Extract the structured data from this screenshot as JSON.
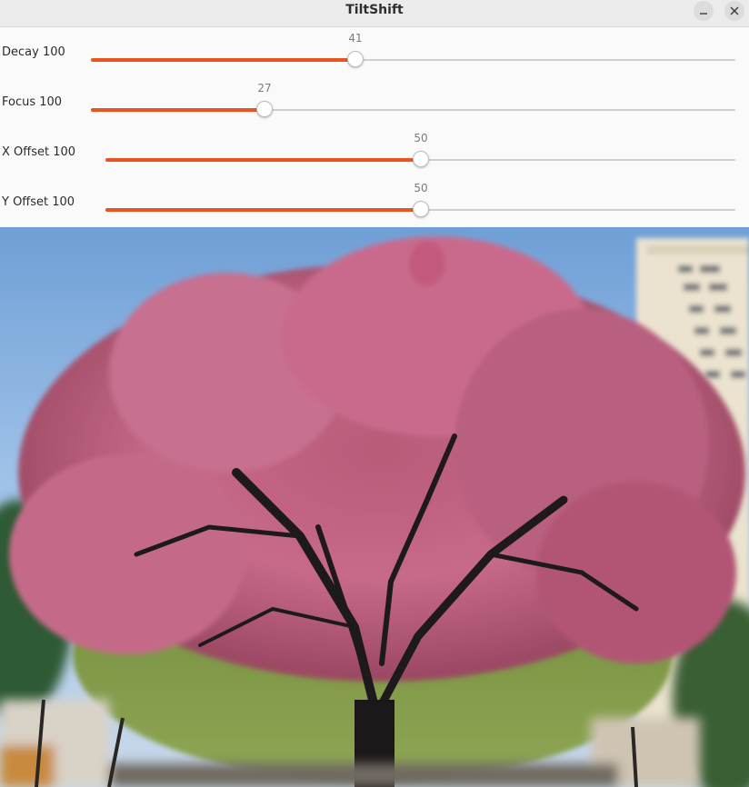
{
  "window": {
    "title": "TiltShift",
    "minimize_icon": "minimize-icon",
    "close_icon": "close-icon"
  },
  "sliders": [
    {
      "label": "Decay 100",
      "value": "41",
      "fraction": 0.41
    },
    {
      "label": "Focus 100",
      "value": "27",
      "fraction": 0.27
    },
    {
      "label": "X Offset 100",
      "value": "50",
      "fraction": 0.5
    },
    {
      "label": "Y Offset 100",
      "value": "50",
      "fraction": 0.5
    }
  ],
  "colors": {
    "accent": "#e95420",
    "track": "#cfcfcf",
    "titlebar": "#ebebeb"
  },
  "image": {
    "subject": "tilt-shift photo of a pink-leafed tree"
  }
}
